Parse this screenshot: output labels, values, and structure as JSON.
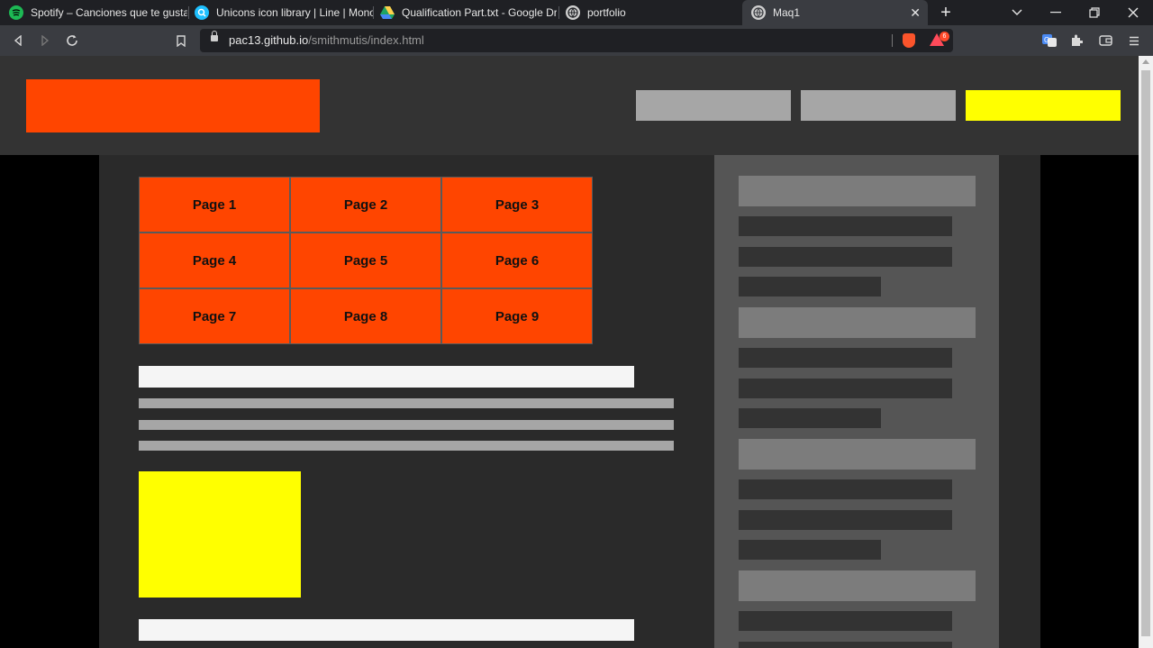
{
  "browser": {
    "tabs": [
      {
        "title": "Spotify – Canciones que te gustan",
        "icon": "spotify-icon",
        "color": "#1db954"
      },
      {
        "title": "Unicons icon library | Line | Monoc",
        "icon": "unicons-icon",
        "color": "#1ec0ff"
      },
      {
        "title": "Qualification Part.txt - Google Driv",
        "icon": "google-drive-icon",
        "color": "#fbbc04"
      },
      {
        "title": "portfolio",
        "icon": "globe-icon",
        "color": "#cfcfcf"
      },
      {
        "title": "Maq1",
        "icon": "globe-icon",
        "color": "#cfcfcf",
        "active": true
      }
    ],
    "new_tab": "+",
    "address": {
      "host": "pac13.github.io",
      "path": "/smithmutis/index.html"
    },
    "rewards_badge": "6"
  },
  "page": {
    "colors": {
      "accent": "#ff4500",
      "highlight": "#ffff00",
      "header_bg": "#333333",
      "content_bg": "#2a2a2a",
      "sidebar_bg": "#555555"
    },
    "grid": [
      "Page 1",
      "Page 2",
      "Page 3",
      "Page 4",
      "Page 5",
      "Page 6",
      "Page 7",
      "Page 8",
      "Page 9"
    ]
  }
}
